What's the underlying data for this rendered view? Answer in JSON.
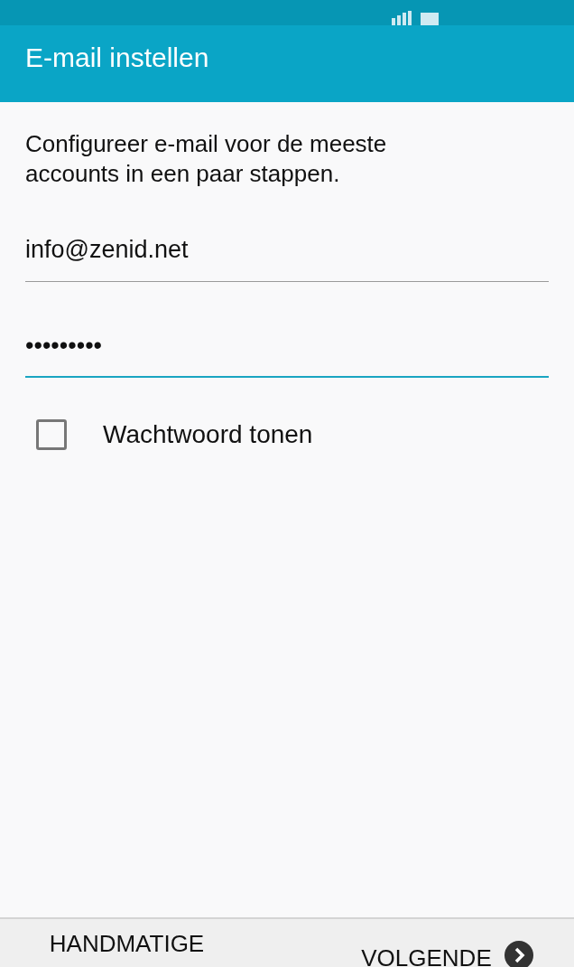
{
  "app_bar": {
    "title": "E-mail instellen"
  },
  "intro": "Configureer e-mail voor de meeste accounts in een paar stappen.",
  "email_field": {
    "value": "info@zenid.net",
    "focused": false
  },
  "password_field": {
    "value": "•••••••••",
    "focused": true
  },
  "show_password": {
    "label": "Wachtwoord tonen",
    "checked": false
  },
  "buttons": [
    {
      "kind": "text",
      "label": "HANDMATIGE"
    },
    {
      "kind": "next",
      "label": "VOLGENDE"
    }
  ]
}
